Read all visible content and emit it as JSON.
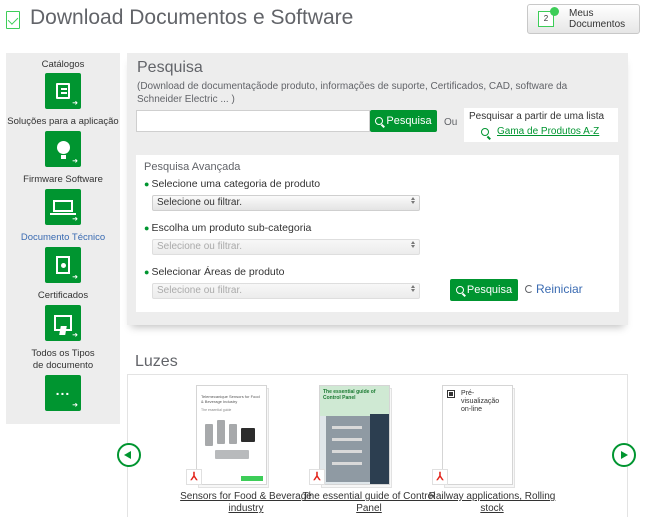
{
  "header": {
    "title": "Download Documentos e Software",
    "my_documents": {
      "badge": "2",
      "label": "Meus Documentos"
    }
  },
  "sidebar": {
    "items": [
      {
        "label": "Catálogos",
        "icon": "catalog-icon",
        "active": false
      },
      {
        "label": "Soluções para a aplicação",
        "icon": "lightbulb-icon",
        "active": false
      },
      {
        "label": "Firmware Software",
        "icon": "laptop-icon",
        "active": false
      },
      {
        "label": "Documento Técnico",
        "icon": "technical-document-icon",
        "active": true
      },
      {
        "label": "Certificados",
        "icon": "certificate-icon",
        "active": false
      },
      {
        "label": "Todos os Tipos de documento",
        "icon": "more-icon",
        "active": false
      }
    ]
  },
  "search": {
    "title": "Pesquisa",
    "description": "(Download de documentaçãode produto, informações de suporte, Certificados, CAD, software da Schneider Electric ... )",
    "input_value": "",
    "input_placeholder": "",
    "button_label": "Pesquisa",
    "or_label": "Ou",
    "list_title": "Pesquisar a partir de uma lista",
    "az_link": "Gama de Produtos A-Z"
  },
  "advanced": {
    "title": "Pesquisa Avançada",
    "fields": [
      {
        "label": "Selecione uma categoria de produto",
        "placeholder": "Selecione ou filtrar.",
        "enabled": true
      },
      {
        "label": "Escolha um produto sub-categoria",
        "placeholder": "Selecione ou filtrar.",
        "enabled": false
      },
      {
        "label": "Selecionar Áreas de produto",
        "placeholder": "Selecione ou filtrar.",
        "enabled": false
      }
    ],
    "search_button": "Pesquisa",
    "reset_label": "Reiniciar"
  },
  "highlights": {
    "title": "Luzes",
    "items": [
      {
        "title": "Sensors for Food & Beverage industry",
        "file_type": "pdf",
        "cover_heading": "Telemecanique Sensors for Food & Beverage Industry",
        "cover_subtitle": "The essential guide"
      },
      {
        "title": "The essential guide of Control Panel",
        "file_type": "pdf",
        "cover_heading": "The essential guide of Control Panel"
      },
      {
        "title": "Railway applications, Rolling stock",
        "file_type": "pdf",
        "cover_heading": "Pré-visualização on-line"
      }
    ]
  },
  "colors": {
    "brand_green": "#009530",
    "light_green": "#3dcd58",
    "link_blue": "#3a6bb2",
    "panel_grey": "#ededed",
    "title_grey": "#626469"
  }
}
